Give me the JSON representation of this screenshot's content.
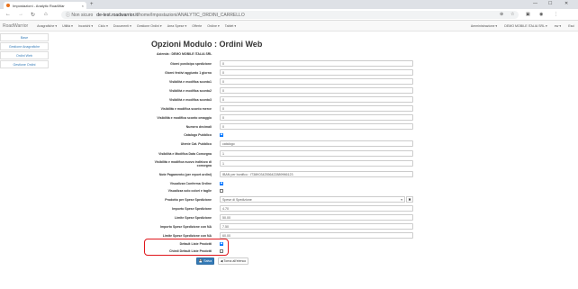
{
  "browser": {
    "tab_title": "Impostazioni - Analytic RoadWar",
    "tab_close": "×",
    "new_tab": "+",
    "win_min": "—",
    "win_max": "☐",
    "win_close": "✕",
    "back": "←",
    "forward": "→",
    "reload": "↻",
    "home": "⌂",
    "not_secure": "ⓘ Non sicuro",
    "url_domain": "de-test.roadwarrior.it",
    "url_path": "/home/Impostazioni/ANALYTIC_ORDINI_CARRELLO"
  },
  "appnav": {
    "brand": "RoadWarrior",
    "menu": [
      "Anagrafiche ▾",
      "Utilità ▾",
      "Incarichi ▾",
      "Ciclo ▾",
      "Documenti ▾",
      "Gestione Ordini ▾",
      "Area Spese ▾",
      "Offerte",
      "Ordine ▾",
      "Tablet ▾"
    ],
    "right": [
      "Amministrazione ▾",
      "DEMO MOBILE ITALIA SRL ▾",
      "ew ▾",
      "Esci"
    ]
  },
  "sidebar": {
    "items": [
      "Base",
      "Gestione Anagrafiche",
      "Ordini Web",
      "Gestione Ordini"
    ]
  },
  "page": {
    "title": "Opzioni Modulo : Ordini Web",
    "azienda": "Azienda : DEMO MOBILE ITALIA SRL"
  },
  "form": {
    "giorni_posticipo": {
      "label": "Giorni posticipo spedizione",
      "value": "0"
    },
    "giorni_festivi": {
      "label": "Giorni festivi aggiunto 1 giorno",
      "value": "0"
    },
    "sconto1": {
      "label": "Visibilità e modifica sconto1",
      "value": "0"
    },
    "sconto2": {
      "label": "Visibilità e modifica sconto2",
      "value": "0"
    },
    "sconto3": {
      "label": "Visibilità e modifica sconto3",
      "value": "0"
    },
    "sconto_merce": {
      "label": "Visibilità e modifica sconto merce",
      "value": "0"
    },
    "sconto_omaggio": {
      "label": "Visibilità e modifica sconto omaggio",
      "value": "0"
    },
    "numero_decimali": {
      "label": "Numero decimali",
      "value": "0"
    },
    "catalogo_pubblico": {
      "label": "Catalogo Pubblico",
      "checked": true
    },
    "utente_cat": {
      "label": "Utente Cat. Pubblico",
      "value": "catalogo"
    },
    "data_consegna": {
      "label": "Visibilità e Modifica Data Consegna",
      "value": "1"
    },
    "nuovo_indirizzo": {
      "label": "Visibilità e modifica nuovo indirizzo di consegna",
      "value": "1"
    },
    "note_pagamento": {
      "label": "Note Pagamento (per report ordini)",
      "value": "IBAN per bonifico : IT38K0342556422889966123"
    },
    "conferma_ordine": {
      "label": "Visualizza Conferma Ordine",
      "checked": true
    },
    "colori_taglie": {
      "label": "Visualizza solo colori e taglie",
      "checked": false
    },
    "prodotto_spese": {
      "label": "Prodotto per Spese Spedizione",
      "value": "Spese di Spedizione",
      "clear": "✖"
    },
    "importo_spese": {
      "label": "Importo Spese Spedizione",
      "value": "4.70"
    },
    "limite_spese": {
      "label": "Limite Spese Spedizione",
      "value": "50.00"
    },
    "importo_spese_na": {
      "label": "Importo Spese Spedizione con NA",
      "value": "7.50"
    },
    "limite_spese_na": {
      "label": "Limite Spese Spedizione con NA",
      "value": "60.00"
    },
    "default_listini": {
      "label": "Default Liste Prodotti",
      "checked": true
    },
    "chiedi_default": {
      "label": "Chiedi Default Liste Prodotti",
      "checked": false
    }
  },
  "buttons": {
    "save": "💾 Salva",
    "back": "◀ Torna all'elenco"
  }
}
